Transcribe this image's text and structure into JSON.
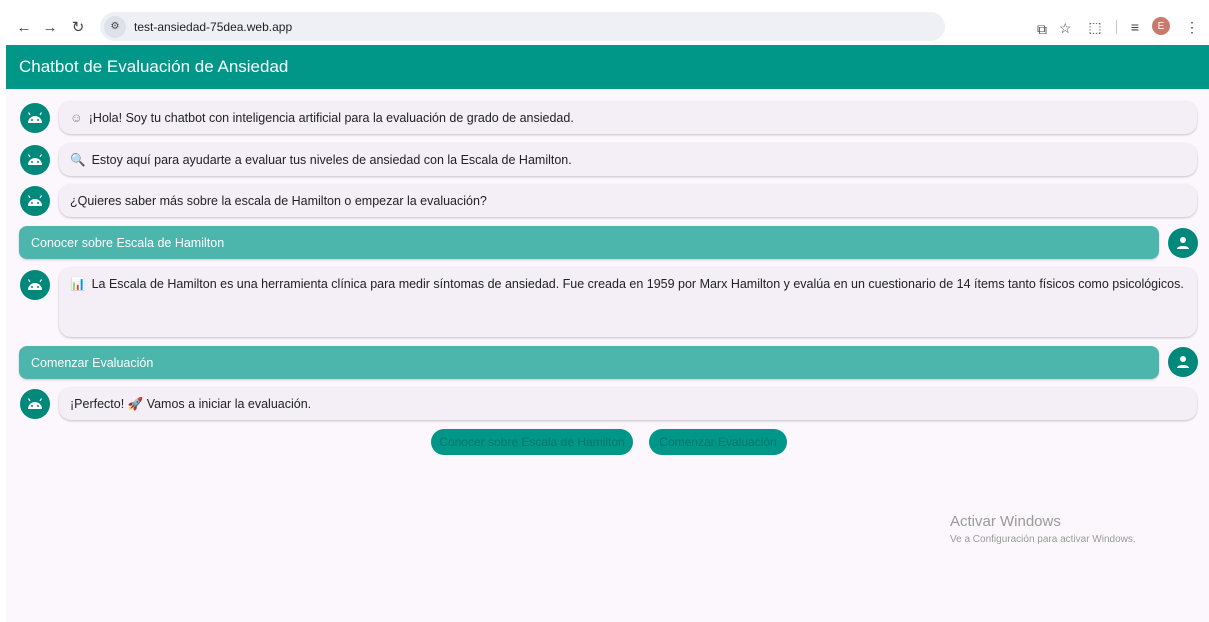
{
  "browser": {
    "url": "test-ansiedad-75dea.web.app",
    "profile_initial": "E"
  },
  "app": {
    "title": "Chatbot de Evaluación de Ansiedad",
    "accent_color": "#009688",
    "user_bubble_color": "#4db6ac"
  },
  "messages": [
    {
      "sender": "bot",
      "emoji": "☺",
      "text": "¡Hola! Soy tu chatbot con inteligencia artificial para la evaluación de  grado de ansiedad."
    },
    {
      "sender": "bot",
      "emoji": "🔍",
      "text": "Estoy aquí para ayudarte a evaluar tus niveles de ansiedad con la Escala de Hamilton."
    },
    {
      "sender": "bot",
      "emoji": "",
      "text": "¿Quieres saber más sobre la escala de Hamilton o empezar la evaluación?"
    },
    {
      "sender": "user",
      "text": "Conocer sobre Escala de Hamilton"
    },
    {
      "sender": "bot",
      "emoji": "📊",
      "text": "La Escala de Hamilton es una herramienta clínica para medir síntomas de ansiedad. Fue creada en 1959 por Marx Hamilton y evalúa en un cuestionario de 14 ítems tanto físicos como psicológicos."
    },
    {
      "sender": "user",
      "text": "Comenzar Evaluación"
    },
    {
      "sender": "bot",
      "emoji": "",
      "text": "¡Perfecto! 🚀 Vamos a iniciar la evaluación."
    }
  ],
  "options": {
    "learn": "Conocer sobre Escala de Hamilton",
    "start": "Comenzar Evaluación"
  },
  "watermark": {
    "title": "Activar Windows",
    "subtitle": "Ve a Configuración para activar Windows."
  }
}
